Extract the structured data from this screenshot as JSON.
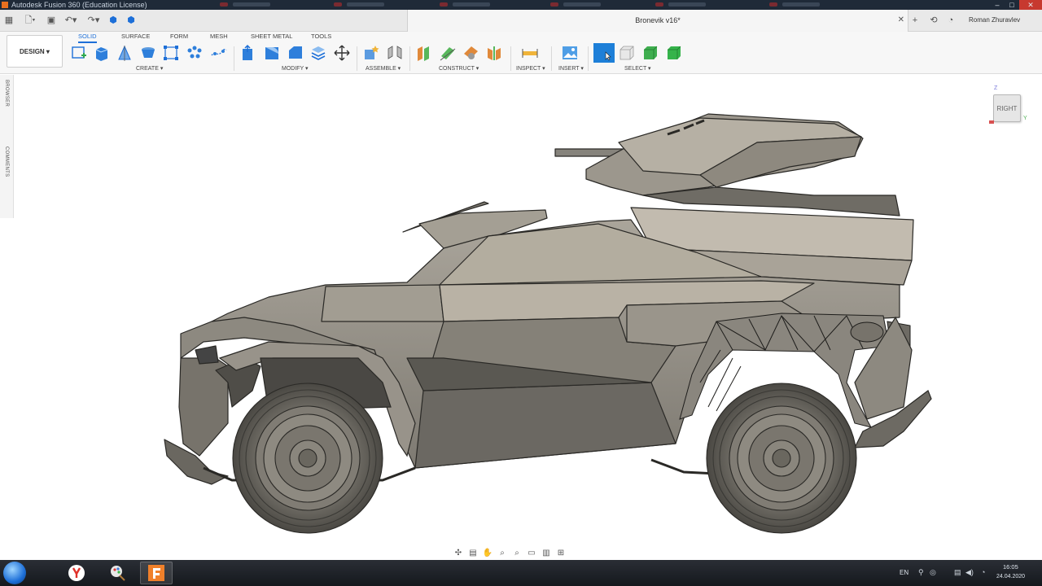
{
  "os_titlebar": {
    "title": "Autodesk Fusion 360 (Education License)"
  },
  "appbar": {
    "document_title": "Bronevik v16*",
    "user_name": "Roman Zhuravlev"
  },
  "toolbar": {
    "workspace_button": "DESIGN ▾",
    "tabs": [
      "SOLID",
      "SURFACE",
      "FORM",
      "MESH",
      "SHEET METAL",
      "TOOLS"
    ],
    "active_tab": "SOLID",
    "groups": [
      "CREATE ▾",
      "MODIFY ▾",
      "ASSEMBLE ▾",
      "CONSTRUCT ▾",
      "INSPECT ▾",
      "INSERT ▾",
      "SELECT ▾"
    ]
  },
  "side_panel": {
    "browser_label": "BROWSER",
    "comments_label": "COMMENTS"
  },
  "viewcube": {
    "face": "RIGHT",
    "axis_z": "Z",
    "axis_y": "Y"
  },
  "taskbar": {
    "language": "EN",
    "time": "16:05",
    "date": "24.04.2020"
  },
  "icons": {
    "app_menu": "grid-icon",
    "file": "file-icon",
    "save": "save-icon",
    "undo": "undo-icon",
    "redo": "redo-icon",
    "orbit": "orbit-icon",
    "pan": "pan-hand-icon",
    "zoom": "zoom-icon",
    "display": "display-settings-icon"
  }
}
